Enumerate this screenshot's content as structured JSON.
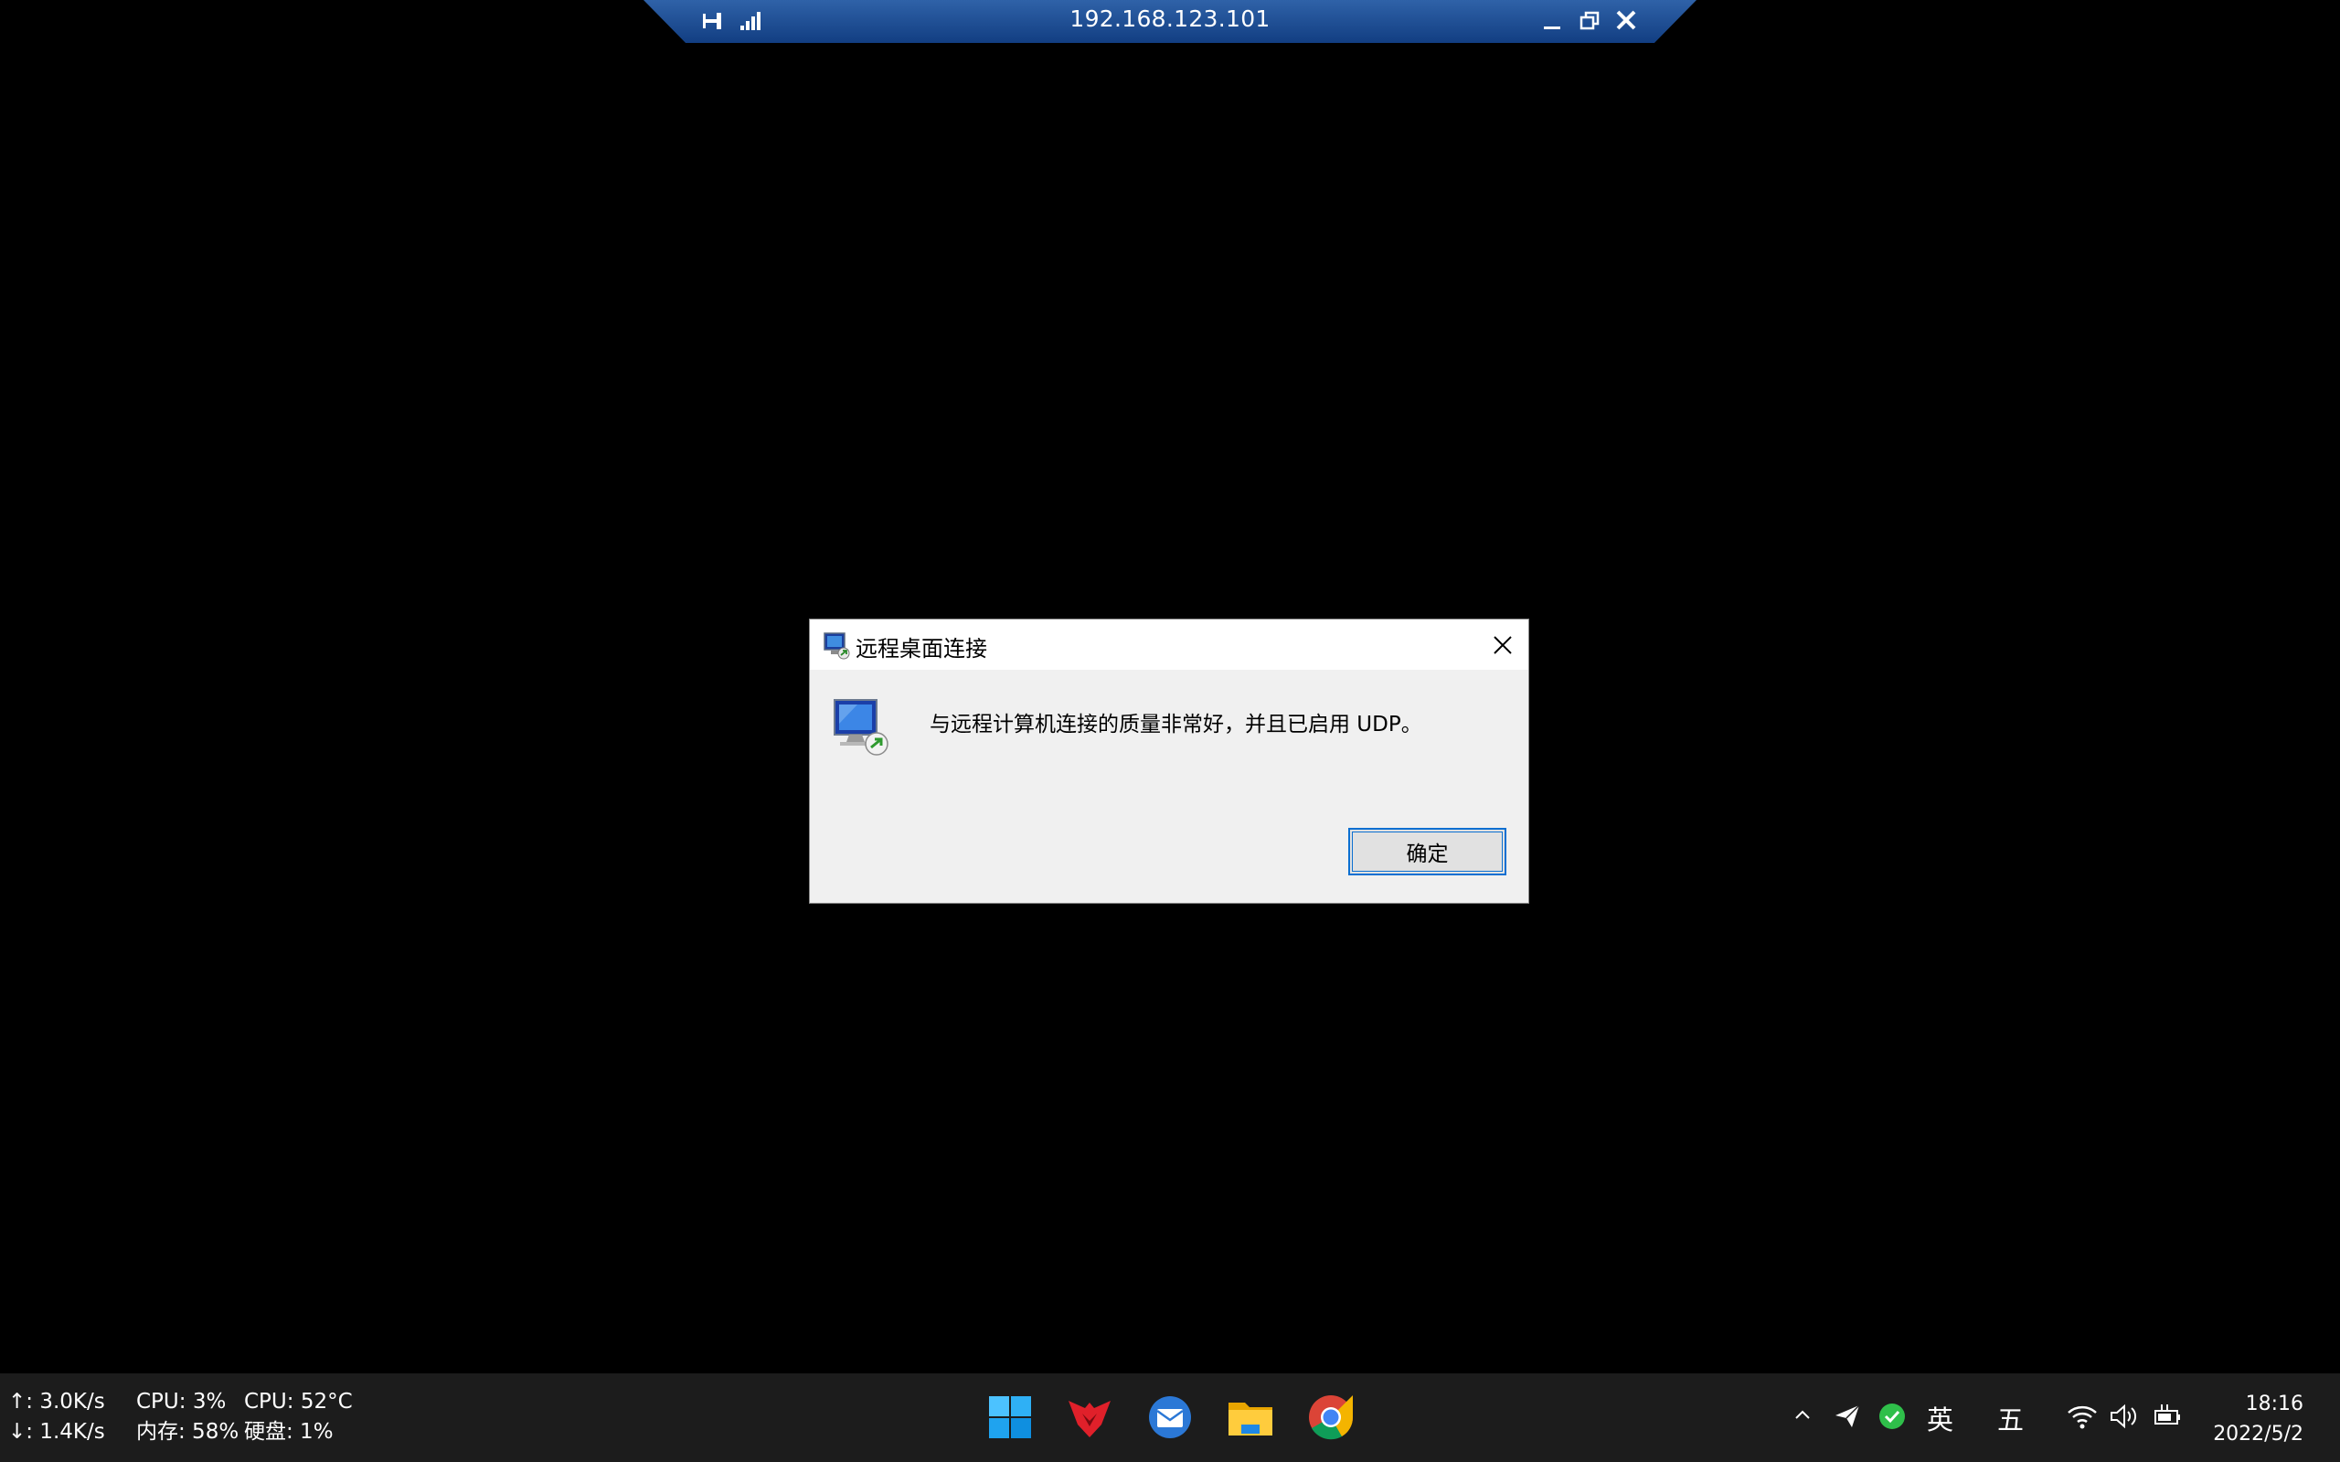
{
  "rdp_bar": {
    "host": "192.168.123.101",
    "icons": [
      "pin-icon",
      "signal-strength-icon",
      "minimize-icon",
      "restore-icon",
      "close-icon"
    ]
  },
  "dialog": {
    "title": "远程桌面连接",
    "message": "与远程计算机连接的质量非常好，并且已启用 UDP。",
    "ok_label": "确定",
    "icons": [
      "remote-desktop-icon",
      "close-icon",
      "remote-desktop-monitor-icon"
    ]
  },
  "taskbar": {
    "system_monitor": {
      "upload": "↑: 3.0K/s",
      "download": "↓: 1.4K/s",
      "cpu_usage": "CPU: 3%",
      "memory": "内存: 58%",
      "cpu_temp": "CPU: 52°C",
      "disk": "硬盘: 1%"
    },
    "apps": [
      "windows-start-icon",
      "red-app-icon",
      "mail-app-icon",
      "file-explorer-icon",
      "chrome-icon"
    ],
    "tray": {
      "ime_lang": "英",
      "ime_mode": "五",
      "icons": [
        "chevron-up-icon",
        "paper-plane-icon",
        "green-check-icon",
        "wifi-icon",
        "volume-icon",
        "battery-icon"
      ]
    },
    "clock": {
      "time": "18:16",
      "date": "2022/5/2"
    }
  },
  "colors": {
    "rdp_bar": "#1f4f96",
    "dialog_bg": "#f0f0f0",
    "button_border": "#0b6fd1",
    "taskbar": "#1c1c1c"
  }
}
